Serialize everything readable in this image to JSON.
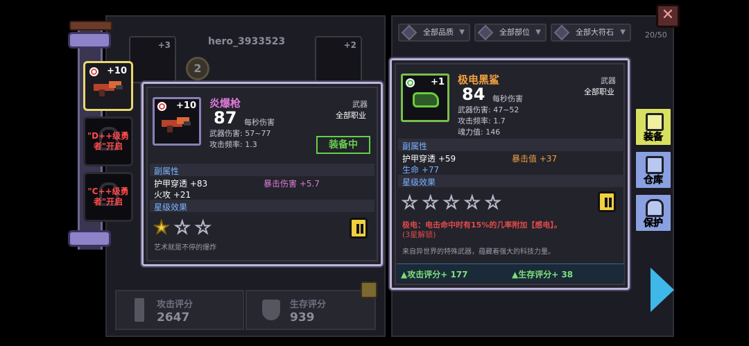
{
  "hero": {
    "name": "hero_3933523"
  },
  "left_slots": [
    {
      "plus": "+10",
      "state": "selected"
    },
    {
      "text": "\"D++级勇者\"开启",
      "state": "locked"
    },
    {
      "text": "\"C++级勇者\"开启",
      "state": "locked"
    }
  ],
  "background": {
    "slot_left_plus": "+3",
    "slot_right_plus": "+2",
    "badge_number": "2",
    "attack_score_label": "攻击评分",
    "attack_score_value": "2647",
    "survive_score_label": "生存评分",
    "survive_score_value": "939"
  },
  "filters": [
    {
      "label": "全部品质",
      "icon": "quality-icon"
    },
    {
      "label": "全部部位",
      "icon": "slot-icon"
    },
    {
      "label": "全部大符石",
      "icon": "rune-icon"
    }
  ],
  "inventory_count": "20/50",
  "card_left": {
    "plus": "+10",
    "name": "炎爆枪",
    "name_color": "#e07ad8",
    "dps": "87",
    "dps_label": "每秒伤害",
    "type": "武器",
    "class": "全部职业",
    "damage": "武器伤害: 57~77",
    "freq": "攻击频率: 1.3",
    "equipped_label": "装备中",
    "sub_attr_title": "副属性",
    "attrs": [
      {
        "text": "护甲穿透 +83"
      },
      {
        "text": "暴击伤害 +5.7"
      },
      {
        "text": "火攻 +21"
      }
    ],
    "star_title": "星级效果",
    "stars_on": 1,
    "stars_total": 3,
    "flavor": "艺术就是不停的爆炸"
  },
  "card_right": {
    "plus": "+1",
    "name": "极电黑鲨",
    "name_color": "#f2a040",
    "dps": "84",
    "dps_label": "每秒伤害",
    "type": "武器",
    "class": "全部职业",
    "damage": "武器伤害: 47~52",
    "freq": "攻击频率: 1.7",
    "soul": "魂力值: 146",
    "sub_attr_title": "副属性",
    "attrs": [
      {
        "text": "护甲穿透 +59"
      },
      {
        "text": "暴击值 +37"
      },
      {
        "text": "生命 +77"
      }
    ],
    "star_title": "星级效果",
    "stars_on": 0,
    "stars_total": 5,
    "effect_main": "极电：电击命中时有15%的几率附加【感电】。",
    "effect_sub": "(3星解锁)",
    "flavor": "来自异世界的特殊武器，蕴藏着强大的科技力量。",
    "attack_rating": "▲攻击评分+ 177",
    "survive_rating": "▲生存评分+ 38"
  },
  "side_buttons": [
    {
      "label": "装备",
      "icon": "armor-icon",
      "color": "#d8e060"
    },
    {
      "label": "仓库",
      "icon": "warehouse-icon",
      "color": "#8aa0e0"
    },
    {
      "label": "保护",
      "icon": "lock-icon",
      "color": "#8aa0e0"
    }
  ],
  "colors": {
    "accent_green": "#66d04a",
    "arrow_blue": "#3fb7e8",
    "crit_pink": "#e07ad8",
    "section_blue": "#7ab2ff"
  }
}
